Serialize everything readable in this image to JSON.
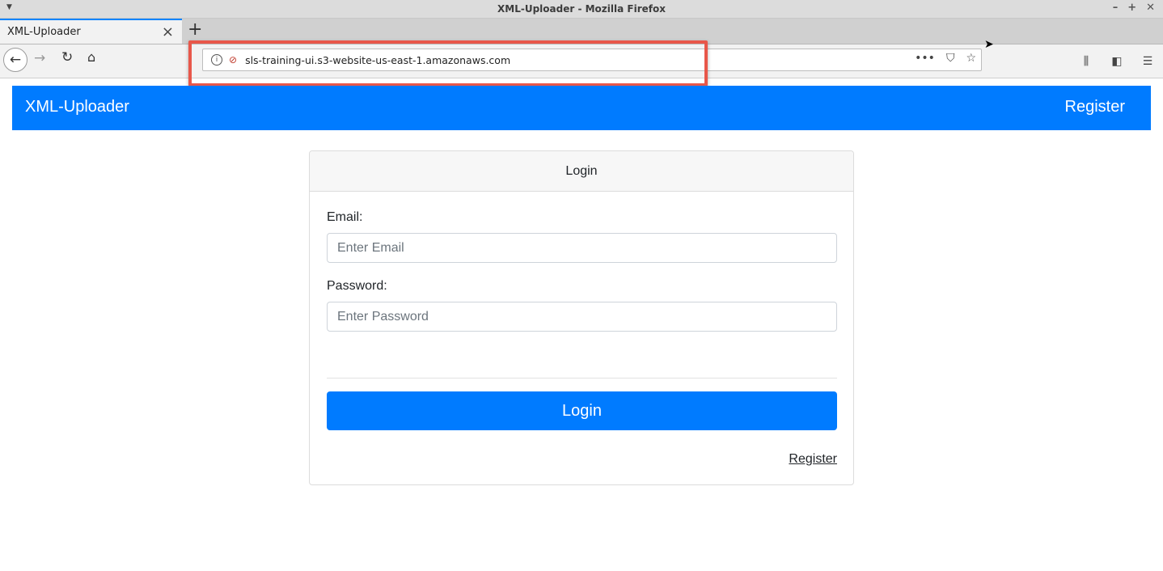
{
  "window": {
    "title": "XML-Uploader - Mozilla Firefox",
    "controls": [
      "–",
      "+",
      "✕"
    ]
  },
  "tab": {
    "label": "XML-Uploader"
  },
  "browser": {
    "url": "sls-training-ui.s3-website-us-east-1.amazonaws.com"
  },
  "app": {
    "brand": "XML-Uploader",
    "nav_register": "Register"
  },
  "login": {
    "header": "Login",
    "email_label": "Email:",
    "email_placeholder": "Enter Email",
    "password_label": "Password:",
    "password_placeholder": "Enter Password",
    "submit_label": "Login",
    "register_link": "Register"
  },
  "colors": {
    "primary": "#007bff",
    "highlight": "#e8574a",
    "tab_accent": "#0a84ff"
  }
}
